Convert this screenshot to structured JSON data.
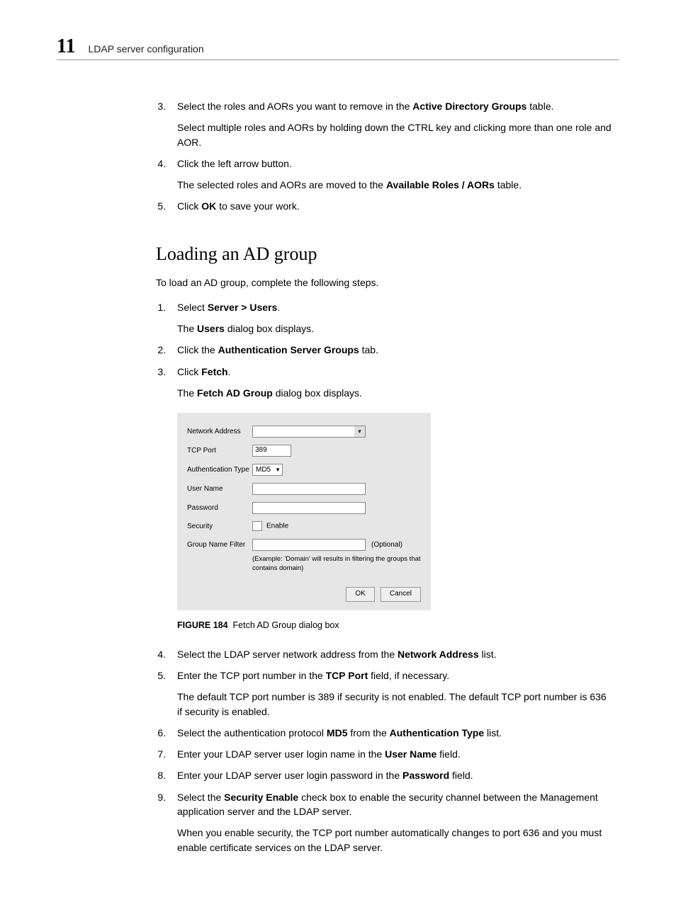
{
  "header": {
    "chapter": "11",
    "title": "LDAP server configuration"
  },
  "topSteps": {
    "s3a": "Select the roles and AORs you want to remove in the ",
    "s3b": "Active Directory Groups",
    "s3c": " table.",
    "s3sub": "Select multiple roles and AORs by holding down the CTRL key and clicking more than one role and AOR.",
    "s4": "Click the left arrow button.",
    "s4sub_a": "The selected roles and AORs are moved to the ",
    "s4sub_b": "Available Roles / AORs",
    "s4sub_c": " table.",
    "s5a": "Click ",
    "s5b": "OK",
    "s5c": " to save your work."
  },
  "h2": "Loading an AD group",
  "intro": "To load an AD group, complete the following steps.",
  "loadSteps": {
    "s1a": "Select ",
    "s1b": "Server > Users",
    "s1c": ".",
    "s1sub_a": "The ",
    "s1sub_b": "Users",
    "s1sub_c": " dialog box displays.",
    "s2a": "Click the ",
    "s2b": "Authentication Server Groups",
    "s2c": " tab.",
    "s3a": "Click ",
    "s3b": "Fetch",
    "s3c": ".",
    "s3sub_a": "The ",
    "s3sub_b": "Fetch AD Group",
    "s3sub_c": " dialog box displays."
  },
  "dialog": {
    "netaddr": "Network Address",
    "tcpport": "TCP Port",
    "tcpport_val": "389",
    "authtype": "Authentication Type",
    "authtype_val": "MD5",
    "username": "User Name",
    "password": "Password",
    "security": "Security",
    "enable": "Enable",
    "groupfilter": "Group Name Filter",
    "optional": "(Optional)",
    "example": "(Example: 'Domain' will results in filtering the groups that contains domain)",
    "ok": "OK",
    "cancel": "Cancel"
  },
  "figcap": {
    "num": "FIGURE 184",
    "text": "Fetch AD Group dialog box"
  },
  "afterSteps": {
    "s4a": "Select the LDAP server network address from the ",
    "s4b": "Network Address",
    "s4c": " list.",
    "s5a": "Enter the TCP port number in the ",
    "s5b": "TCP Port",
    "s5c": " field, if necessary.",
    "s5sub": "The default TCP port number is 389 if security is not enabled. The default TCP port number is 636 if security is enabled.",
    "s6a": "Select the authentication protocol ",
    "s6b": "MD5",
    "s6c": " from the ",
    "s6d": "Authentication Type",
    "s6e": " list.",
    "s7a": "Enter your LDAP server user login name in the ",
    "s7b": "User Name",
    "s7c": " field.",
    "s8a": "Enter your LDAP server user login password in the ",
    "s8b": "Password",
    "s8c": " field.",
    "s9a": "Select the ",
    "s9b": "Security Enable",
    "s9c": " check box to enable the security channel between the Management application server and the LDAP server.",
    "s9sub": "When you enable security, the TCP port number automatically changes to port 636 and you must enable certificate services on the LDAP server."
  }
}
